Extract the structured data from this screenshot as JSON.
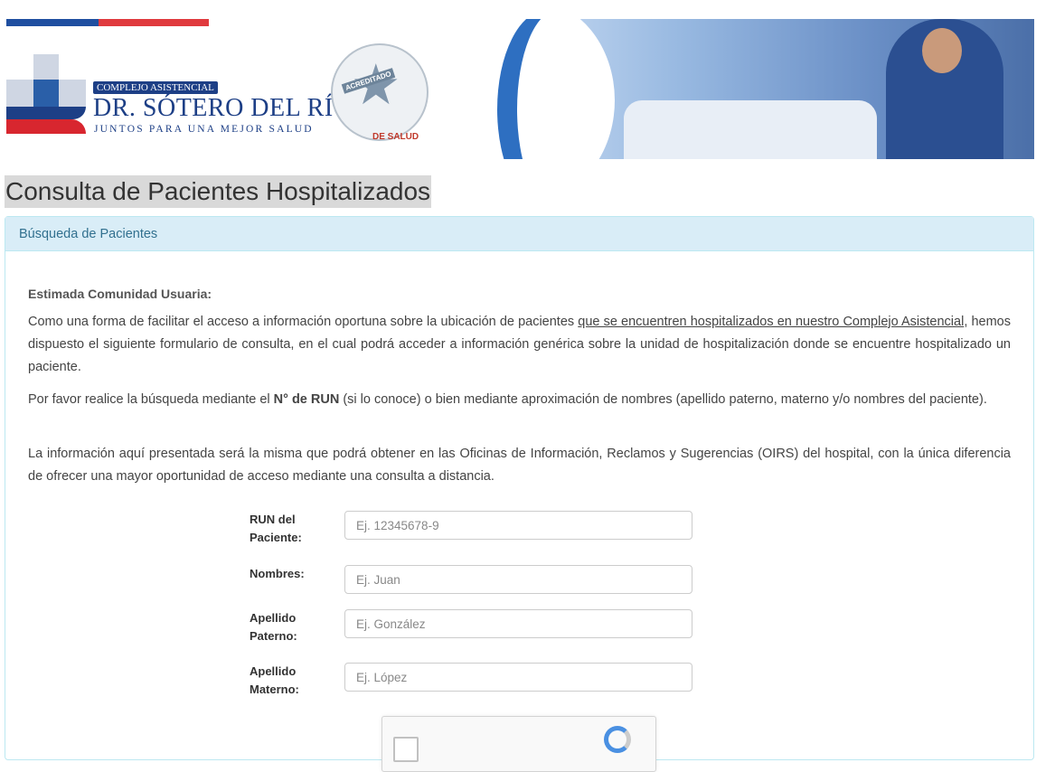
{
  "header": {
    "logo_badge": "COMPLEJO ASISTENCIAL",
    "logo_name": "DR. SÓTERO DEL RÍO",
    "logo_tagline": "JUNTOS PARA UNA MEJOR SALUD",
    "seal_label": "ACREDITADO",
    "seal_footer": "DE SALUD"
  },
  "page": {
    "title": "Consulta de Pacientes Hospitalizados"
  },
  "panel": {
    "heading": "Búsqueda de Pacientes",
    "intro_title": "Estimada Comunidad Usuaria:",
    "para1_before": "Como una forma de facilitar el acceso a información oportuna sobre la ubicación de pacientes ",
    "para1_link": "que se encuentren hospitalizados en nuestro Complejo Asistencial",
    "para1_after": ", hemos dispuesto el siguiente formulario de consulta, en el cual podrá acceder a información genérica sobre la unidad de hospitalización donde se encuentre hospitalizado un paciente.",
    "para2_before": "Por favor realice la búsqueda mediante el ",
    "para2_bold": "N° de RUN",
    "para2_after": " (si lo conoce) o bien mediante aproximación de nombres (apellido paterno, materno y/o nombres del paciente).",
    "para3": "La información aquí presentada será la misma que podrá obtener en las Oficinas de Información, Reclamos y Sugerencias (OIRS) del hospital, con la única diferencia de ofrecer una mayor oportunidad de acceso mediante una consulta a distancia."
  },
  "form": {
    "run_label": "RUN del Paciente:",
    "run_placeholder": "Ej. 12345678-9",
    "nombres_label": "Nombres:",
    "nombres_placeholder": "Ej. Juan",
    "paterno_label": "Apellido Paterno:",
    "paterno_placeholder": "Ej. González",
    "materno_label": "Apellido Materno:",
    "materno_placeholder": "Ej. López"
  },
  "colors": {
    "panel_heading_bg": "#d9edf7",
    "panel_heading_text": "#31708f",
    "flag_blue": "#1f4fa0",
    "flag_red": "#e03a3e"
  }
}
